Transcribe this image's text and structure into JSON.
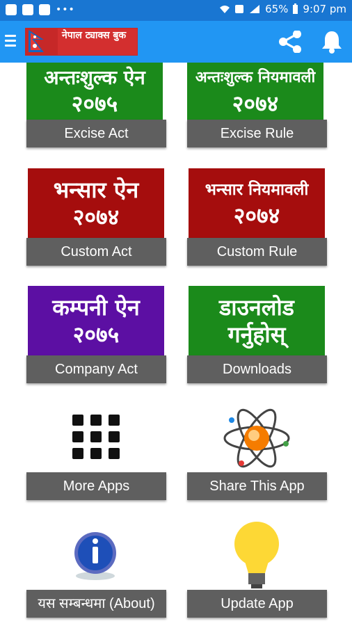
{
  "status_bar": {
    "battery": "65%",
    "time": "9:07 pm"
  },
  "app_bar": {
    "logo_text": "नेपाल ट्याक्स बुक"
  },
  "tiles": [
    {
      "art_line1": "अन्तःशुल्क ऐन",
      "art_line2": "२०७५",
      "caption": "Excise Act",
      "color": "#1b8a1b"
    },
    {
      "art_line1": "अन्तःशुल्क नियमावली",
      "art_line2": "२०७४",
      "caption": "Excise Rule",
      "color": "#1b8a1b"
    },
    {
      "art_line1": "भन्सार ऐन",
      "art_line2": "२०७४",
      "caption": "Custom Act",
      "color": "#a50d0d"
    },
    {
      "art_line1": "भन्सार नियमावली",
      "art_line2": "२०७४",
      "caption": "Custom Rule",
      "color": "#a50d0d"
    },
    {
      "art_line1": "कम्पनी ऐन",
      "art_line2": "२०७५",
      "caption": "Company Act",
      "color": "#5c0fa3"
    },
    {
      "art_line1": "डाउनलोड",
      "art_line2": "गर्नुहोस्",
      "caption": "Downloads",
      "color": "#1b8a1b"
    },
    {
      "caption": "More Apps",
      "icon": "grid-icon"
    },
    {
      "caption": "Share This App",
      "icon": "atom-icon"
    },
    {
      "caption": "यस सम्बन्धमा (About)",
      "icon": "info-icon"
    },
    {
      "caption": "Update App",
      "icon": "lightbulb-icon"
    }
  ],
  "colors": {
    "status_bar": "#1976d2",
    "app_bar": "#2196f3",
    "caption_bg": "#5f5f5f"
  }
}
